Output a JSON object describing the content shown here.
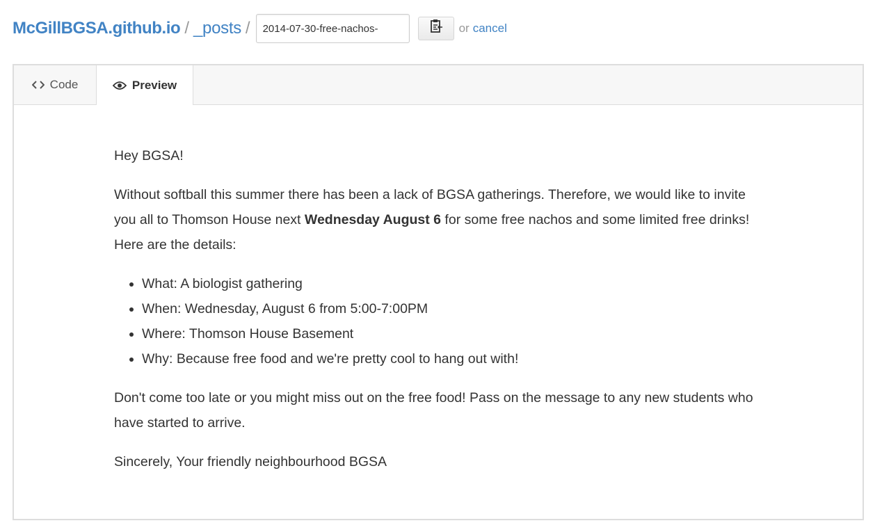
{
  "breadcrumb": {
    "repo": "McGillBGSA.github.io",
    "separator": "/",
    "dir": "_posts",
    "filename_value": "2014-07-30-free-nachos-",
    "or_text": "or",
    "cancel_label": "cancel"
  },
  "icons": {
    "copy": "clipboard-icon",
    "code": "code-brackets-icon",
    "preview": "eye-icon"
  },
  "tabs": {
    "code_label": "Code",
    "preview_label": "Preview",
    "active": "Preview"
  },
  "post": {
    "greeting": "Hey BGSA!",
    "intro_part1": "Without softball this summer there has been a lack of BGSA gatherings. Therefore, we would like to invite you all to Thomson House next ",
    "intro_bold": "Wednesday August 6",
    "intro_part2": " for some free nachos and some limited free drinks! Here are the details:",
    "details": [
      "What: A biologist gathering",
      "When: Wednesday, August 6 from 5:00-7:00PM",
      "Where: Thomson House Basement",
      "Why: Because free food and we're pretty cool to hang out with!"
    ],
    "closing": "Don't come too late or you might miss out on the free food! Pass on the message to any new students who have started to arrive.",
    "signoff": "Sincerely, Your friendly neighbourhood BGSA"
  },
  "colors": {
    "link": "#4183c4",
    "text": "#333333",
    "muted": "#999999",
    "border": "#dddddd",
    "tabbar_bg": "#f7f7f7"
  }
}
